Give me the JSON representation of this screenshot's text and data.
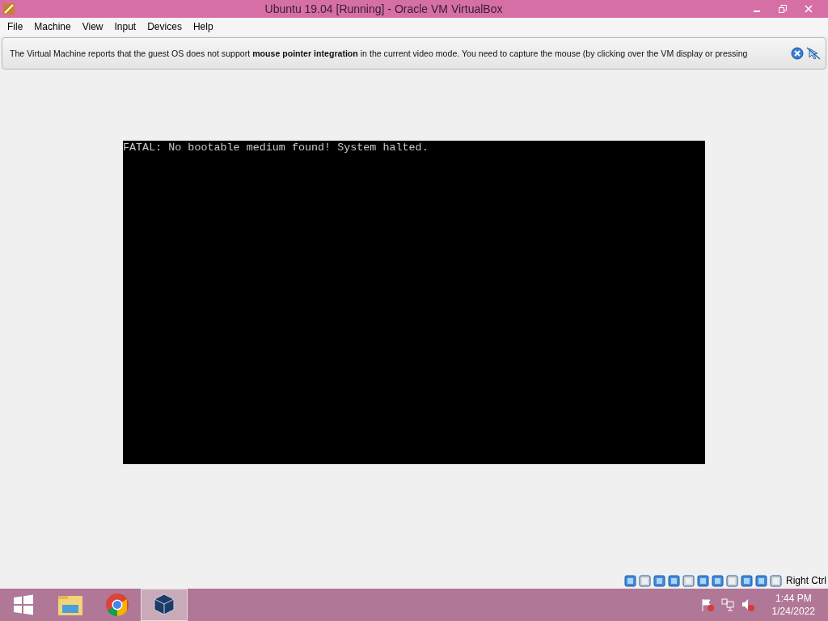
{
  "window": {
    "title": "Ubuntu 19.04 [Running] - Oracle VM VirtualBox"
  },
  "menu": [
    "File",
    "Machine",
    "View",
    "Input",
    "Devices",
    "Help"
  ],
  "notice": {
    "text": "The Virtual Machine reports that the guest OS does not support **mouse pointer integration** in the current video mode. You need to capture the mouse (by clicking over the VM display or pressing"
  },
  "vm_screen": {
    "text": "FATAL: No bootable medium found! System halted."
  },
  "status_bar": {
    "host_key": "Right Ctrl"
  },
  "taskbar": {
    "buttons": [
      {
        "kind": "start",
        "selected": false
      },
      {
        "kind": "explorer",
        "selected": false
      },
      {
        "kind": "chrome",
        "selected": false
      },
      {
        "kind": "virtualbox",
        "selected": true
      }
    ],
    "time": "1:44 PM",
    "date": "1/24/2022"
  }
}
